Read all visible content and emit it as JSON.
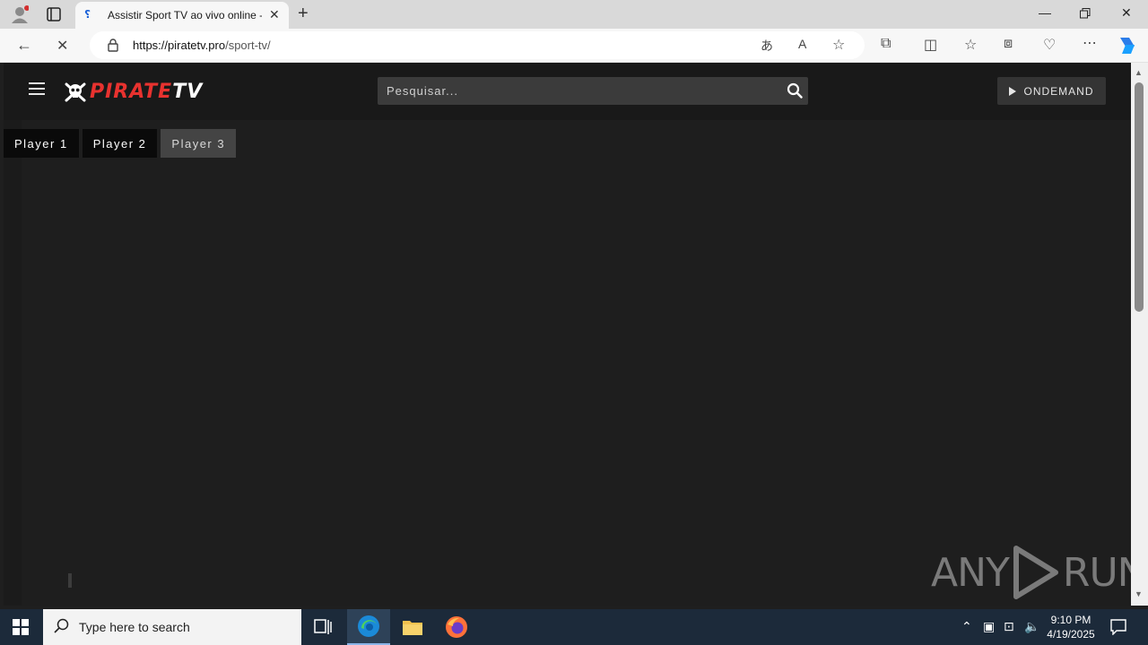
{
  "browser": {
    "tab_title": "Assistir Sport TV ao vivo online - ",
    "url_host": "https://piratetv.pro",
    "url_path": "/sport-tv/"
  },
  "site": {
    "logo_red": "PIRATE",
    "logo_white": "TV",
    "search_placeholder": "Pesquisar...",
    "ondemand_label": "ONDEMAND",
    "players": [
      {
        "label": "Player 1",
        "active": false
      },
      {
        "label": "Player 2",
        "active": false
      },
      {
        "label": "Player 3",
        "active": true
      }
    ],
    "watermark_left": "ANY",
    "watermark_right": "RUN"
  },
  "taskbar": {
    "search_placeholder": "Type here to search",
    "time": "9:10 PM",
    "date": "4/19/2025"
  },
  "colors": {
    "logo_accent": "#e8322f",
    "page_bg": "#1e1e1e",
    "header_bg": "#191919"
  }
}
